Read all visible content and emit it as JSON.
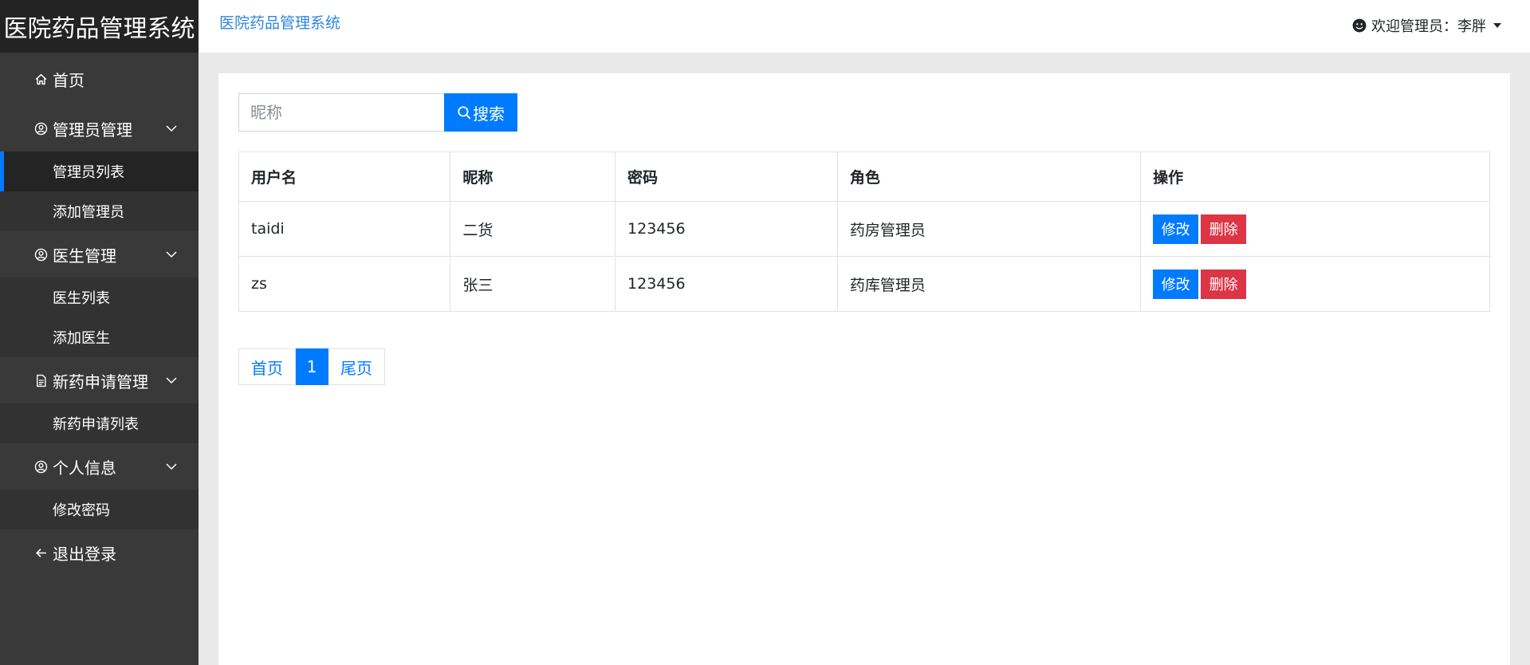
{
  "brand": "医院药品管理系统",
  "topbar": {
    "title": "医院药品管理系统",
    "user_label": "欢迎管理员：李胖"
  },
  "sidebar": {
    "home": "首页",
    "groups": [
      {
        "label": "管理员管理",
        "icon": "user-circle-icon",
        "items": [
          {
            "label": "管理员列表",
            "active": true
          },
          {
            "label": "添加管理员",
            "active": false
          }
        ]
      },
      {
        "label": "医生管理",
        "icon": "user-circle-icon",
        "items": [
          {
            "label": "医生列表",
            "active": false
          },
          {
            "label": "添加医生",
            "active": false
          }
        ]
      },
      {
        "label": "新药申请管理",
        "icon": "document-icon",
        "items": [
          {
            "label": "新药申请列表",
            "active": false
          }
        ]
      },
      {
        "label": "个人信息",
        "icon": "user-circle-icon",
        "items": [
          {
            "label": "修改密码",
            "active": false
          }
        ]
      }
    ],
    "logout": "退出登录"
  },
  "search": {
    "placeholder": "昵称",
    "value": "",
    "button": "搜索"
  },
  "table": {
    "headers": [
      "用户名",
      "昵称",
      "密码",
      "角色",
      "操作"
    ],
    "rows": [
      {
        "username": "taidi",
        "nickname": "二货",
        "password": "123456",
        "role": "药房管理员"
      },
      {
        "username": "zs",
        "nickname": "张三",
        "password": "123456",
        "role": "药库管理员"
      }
    ],
    "edit_label": "修改",
    "delete_label": "删除"
  },
  "pagination": {
    "first": "首页",
    "current": "1",
    "last": "尾页"
  },
  "colors": {
    "primary": "#007bff",
    "danger": "#dc3545",
    "sidebar": "#393939",
    "brand_bg": "#232323"
  }
}
